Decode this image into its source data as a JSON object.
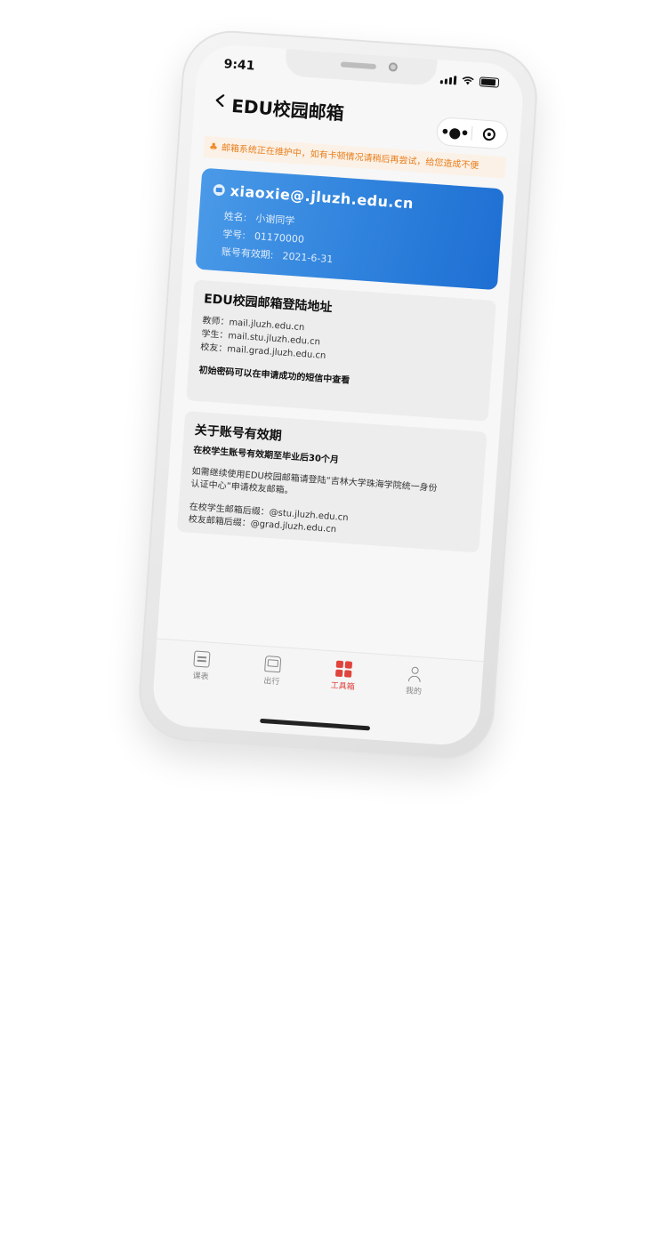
{
  "status_bar": {
    "time": "9:41"
  },
  "nav": {
    "title": "EDU校园邮箱"
  },
  "notice": {
    "text": "邮箱系统正在维护中，如有卡顿情况请稍后再尝试，给您造成不便"
  },
  "account_card": {
    "email": "xiaoxie@.jluzh.edu.cn",
    "name_label": "姓名:",
    "name_value": "小谢同学",
    "id_label": "学号:",
    "id_value": "01170000",
    "validity_label": "账号有效期:",
    "validity_value": "2021-6-31"
  },
  "login_panel": {
    "title": "EDU校园邮箱登陆地址",
    "teacher": "教师：mail.jluzh.edu.cn",
    "student": "学生：mail.stu.jluzh.edu.cn",
    "alumni": "校友：mail.grad.jluzh.edu.cn",
    "password_note": "初始密码可以在申请成功的短信中查看"
  },
  "validity_panel": {
    "title": "关于账号有效期",
    "subtitle": "在校学生账号有效期至毕业后30个月",
    "continue_line1": "如需继续使用EDU校园邮箱请登陆“吉林大学珠海学院统一身份",
    "continue_line2": "认证中心”申请校友邮箱。",
    "student_suffix": "在校学生邮箱后缀：@stu.jluzh.edu.cn",
    "alumni_suffix": "校友邮箱后缀：@grad.jluzh.edu.cn"
  },
  "tabbar": {
    "tabs": [
      {
        "label": "课表",
        "icon": "schedule-icon",
        "active": false
      },
      {
        "label": "出行",
        "icon": "bus-icon",
        "active": false
      },
      {
        "label": "工具箱",
        "icon": "toolbox-icon",
        "active": true
      },
      {
        "label": "我的",
        "icon": "user-icon",
        "active": false
      }
    ]
  },
  "colors": {
    "card_gradient_start": "#4a9ae8",
    "card_gradient_end": "#1e6fd3",
    "notice_text": "#e97d1b",
    "notice_bg": "#fbf1e6",
    "active_tab": "#e0443c"
  }
}
